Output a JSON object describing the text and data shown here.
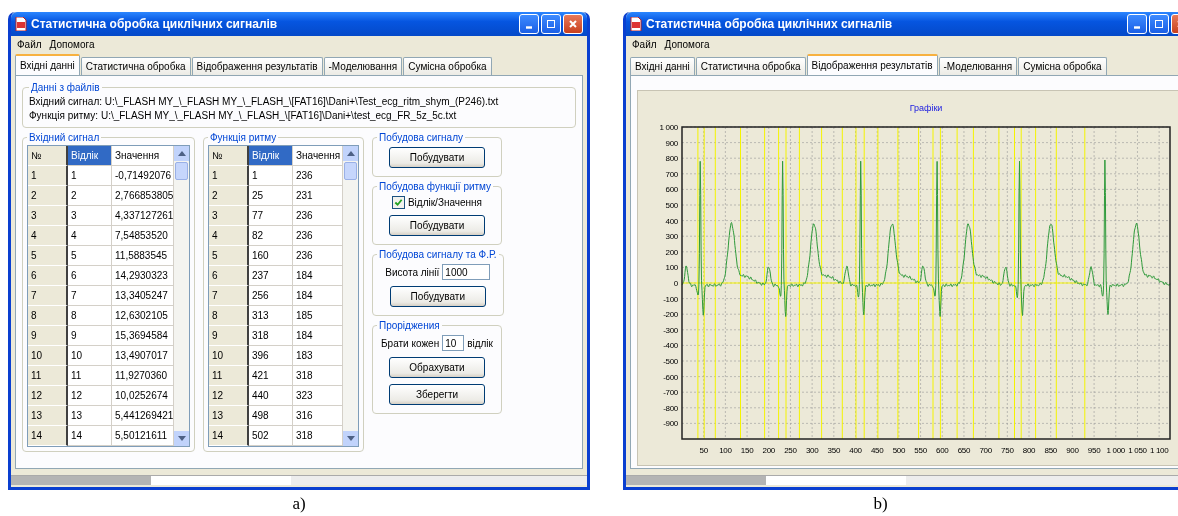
{
  "panels": [
    {
      "caption": "a)",
      "title": "Статистична обробка циклічних сигналів",
      "menu": [
        "Файл",
        "Допомога"
      ],
      "tabs": [
        {
          "label": "Вхідні данні",
          "selected": true
        },
        {
          "label": "Статистична обробка",
          "selected": false
        },
        {
          "label": "Відображення результатів",
          "selected": false
        },
        {
          "label": "-Моделювання",
          "selected": false
        },
        {
          "label": "Сумісна обробка",
          "selected": false
        }
      ],
      "kind": "input_data",
      "files": {
        "legend": "Данні з файлів",
        "lines": [
          "Вхідний сигнал: U:\\_FLASH MY_\\_FLASH MY_\\_FLASH_\\[FAT16]\\Dani+\\Test_ecg_ritm_shym_(P246).txt",
          "Функція ритму: U:\\_FLASH MY_\\_FLASH MY_\\_FLASH_\\[FAT16]\\Dani+\\test_ecg_FR_5z_5c.txt"
        ]
      },
      "tables": [
        {
          "legend": "Вхідний сигнал",
          "columns": [
            {
              "label": "№",
              "selected": false
            },
            {
              "label": "Відлік",
              "selected": true
            },
            {
              "label": "Значення",
              "selected": false
            }
          ],
          "rows": [
            [
              "1",
              "1",
              "-0,71492076"
            ],
            [
              "2",
              "2",
              "2,766853805"
            ],
            [
              "3",
              "3",
              "4,337127261"
            ],
            [
              "4",
              "4",
              "7,54853520"
            ],
            [
              "5",
              "5",
              "11,5883545"
            ],
            [
              "6",
              "6",
              "14,2930323"
            ],
            [
              "7",
              "7",
              "13,3405247"
            ],
            [
              "8",
              "8",
              "12,6302105"
            ],
            [
              "9",
              "9",
              "15,3694584"
            ],
            [
              "10",
              "10",
              "13,4907017"
            ],
            [
              "11",
              "11",
              "11,9270360"
            ],
            [
              "12",
              "12",
              "10,0252674"
            ],
            [
              "13",
              "13",
              "5,441269421"
            ],
            [
              "14",
              "14",
              "5,50121611"
            ]
          ]
        },
        {
          "legend": "Функція ритму",
          "columns": [
            {
              "label": "№",
              "selected": false
            },
            {
              "label": "Відлік",
              "selected": true
            },
            {
              "label": "Значення",
              "selected": false
            }
          ],
          "rows": [
            [
              "1",
              "1",
              "236"
            ],
            [
              "2",
              "25",
              "231"
            ],
            [
              "3",
              "77",
              "236"
            ],
            [
              "4",
              "82",
              "236"
            ],
            [
              "5",
              "160",
              "236"
            ],
            [
              "6",
              "237",
              "184"
            ],
            [
              "7",
              "256",
              "184"
            ],
            [
              "8",
              "313",
              "185"
            ],
            [
              "9",
              "318",
              "184"
            ],
            [
              "10",
              "396",
              "183"
            ],
            [
              "11",
              "421",
              "318"
            ],
            [
              "12",
              "440",
              "323"
            ],
            [
              "13",
              "498",
              "316"
            ],
            [
              "14",
              "502",
              "318"
            ]
          ]
        }
      ],
      "actions": [
        {
          "legend": "Побудова сигналу",
          "items": [
            {
              "kind": "button",
              "label": "Побудувати"
            }
          ]
        },
        {
          "legend": "Побудова функції ритму",
          "items": [
            {
              "kind": "checkbox",
              "label": "Відлік/Значення",
              "checked": true
            },
            {
              "kind": "button",
              "label": "Побудувати"
            }
          ]
        },
        {
          "legend": "Побудова сигналу та Ф.Р.",
          "items": [
            {
              "kind": "field",
              "label": "Висота лінії",
              "value": "1000"
            },
            {
              "kind": "button",
              "label": "Побудувати"
            }
          ]
        },
        {
          "legend": "Проріджения",
          "items": [
            {
              "kind": "field",
              "label": "Брати кожен",
              "value": "10",
              "suffix": "відлік"
            },
            {
              "kind": "button",
              "label": "Обрахувати"
            },
            {
              "kind": "button",
              "label": "Зберегти"
            }
          ]
        }
      ]
    },
    {
      "caption": "b)",
      "title": "Статистична обробка циклічних сигналів",
      "menu": [
        "Файл",
        "Допомога"
      ],
      "tabs": [
        {
          "label": "Вхідні данні",
          "selected": false
        },
        {
          "label": "Статистична обробка",
          "selected": false
        },
        {
          "label": "Відображення результатів",
          "selected": true
        },
        {
          "label": "-Моделювання",
          "selected": false
        },
        {
          "label": "Сумісна обробка",
          "selected": false
        }
      ],
      "kind": "chart",
      "chart": {
        "title": "Графіки",
        "y_ticks": [
          "1 000",
          "900",
          "800",
          "700",
          "600",
          "500",
          "400",
          "300",
          "200",
          "100",
          "0",
          "-100",
          "-200",
          "-300",
          "-400",
          "-500",
          "-600",
          "-700",
          "-800",
          "-900"
        ],
        "x_ticks": [
          "50",
          "100",
          "150",
          "200",
          "250",
          "300",
          "350",
          "400",
          "450",
          "500",
          "550",
          "600",
          "650",
          "700",
          "750",
          "800",
          "850",
          "900",
          "950",
          "1 000",
          "1 050",
          "1 100"
        ]
      }
    }
  ]
}
